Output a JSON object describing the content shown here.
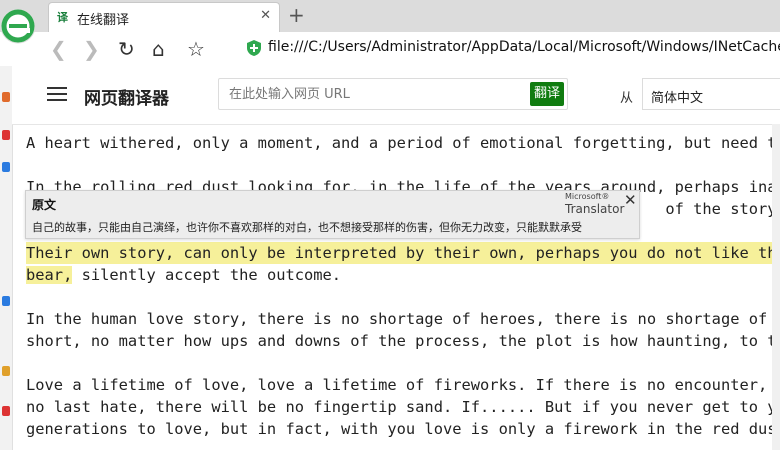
{
  "browser": {
    "tab_favicon": "译",
    "tab_title": "在线翻译",
    "tab_close": "✕",
    "new_tab": "+",
    "url": "file:///C:/Users/Administrator/AppData/Local/Microsoft/Windows/INetCache"
  },
  "app": {
    "title": "网页翻译器",
    "url_placeholder": "在此处输入网页 URL",
    "translate_button": "翻译",
    "from_label": "从",
    "source_language": "简体中文"
  },
  "content": {
    "paragraphs": [
      "A heart withered, only a moment, and a period of emotional forgetting, but need t",
      "In the rolling red dust looking for, in the life of the years around, perhaps ina",
      "                                                                     of the story, i",
      "Their own story, can only be interpreted by their own, perhaps you do not like th",
      "silently accept the outcome.",
      "In the human love story, there is no shortage of heroes, there is no shortage of",
      "short, no matter how ups and downs of the process, the plot is how haunting, to t",
      "Love a lifetime of love, love a lifetime of fireworks. If there is no encounter,",
      "no last hate, there will be no fingertip sand. If...... But if you never get to y",
      "generations to love, but in fact, with you love is only a firework in the red dus"
    ],
    "highlight_tail": "bear,"
  },
  "popup": {
    "label": "原文",
    "brand_line1": "Microsoft®",
    "brand_line2": "Translator",
    "close": "✕",
    "text": "自己的故事，只能由自己演绎，也许你不喜欢那样的对白，也不想接受那样的伤害，但你无力改变，只能默默承受"
  }
}
